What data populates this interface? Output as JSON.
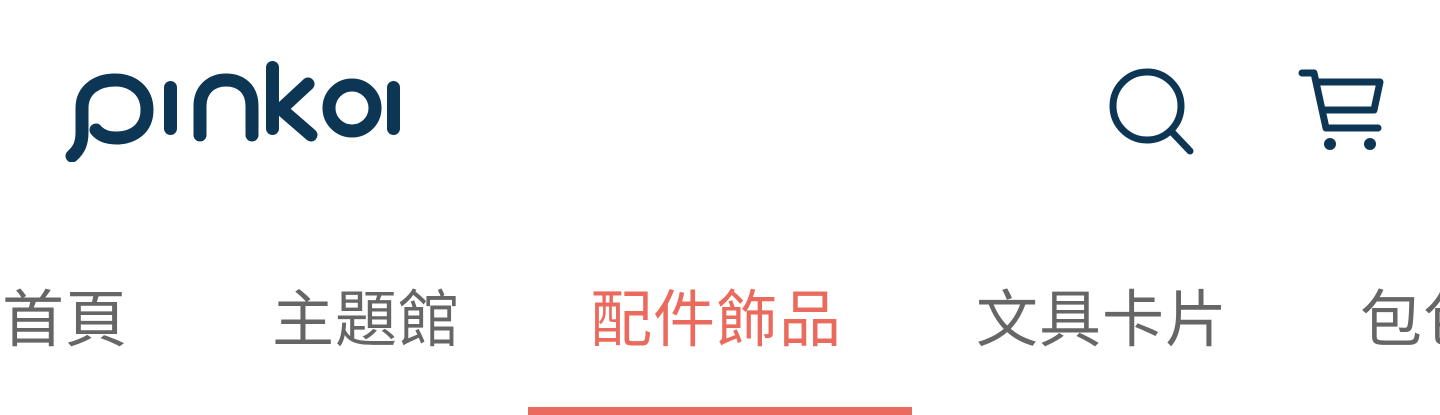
{
  "header": {
    "logo_text": "pinkoi",
    "search_icon": "search-icon",
    "cart_icon": "cart-icon"
  },
  "colors": {
    "brand": "#0c3654",
    "accent": "#ea6b5e",
    "tab_text": "#666666"
  },
  "nav": {
    "tabs": [
      {
        "label": "首頁",
        "active": false
      },
      {
        "label": "主題館",
        "active": false
      },
      {
        "label": "配件飾品",
        "active": true
      },
      {
        "label": "文具卡片",
        "active": false
      },
      {
        "label": "包包",
        "active": false
      }
    ]
  }
}
